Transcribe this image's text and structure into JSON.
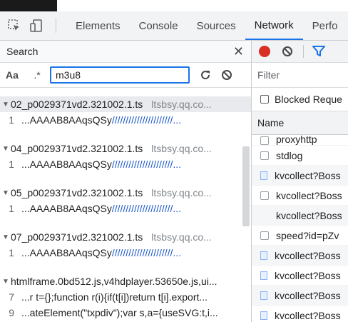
{
  "tabs": [
    "Elements",
    "Console",
    "Sources",
    "Network",
    "Perfo"
  ],
  "active_tab": "Network",
  "search": {
    "title": "Search",
    "case_label": "Aa",
    "regex_label": ".*",
    "query": "m3u8"
  },
  "results": [
    {
      "file": "02_p0029371vd2.321002.1.ts",
      "host": "ltsbsy.qq.co...",
      "lines": [
        {
          "n": "1",
          "pre": "...AAAAB8AAqsQSy",
          "slashes": "//////////////////////..."
        }
      ],
      "selected": true
    },
    {
      "file": "04_p0029371vd2.321002.1.ts",
      "host": "ltsbsy.qq.co...",
      "lines": [
        {
          "n": "1",
          "pre": "...AAAAB8AAqsQSy",
          "slashes": "//////////////////////..."
        }
      ]
    },
    {
      "file": "05_p0029371vd2.321002.1.ts",
      "host": "ltsbsy.qq.co...",
      "lines": [
        {
          "n": "1",
          "pre": "...AAAAB8AAqsQSy",
          "slashes": "//////////////////////..."
        }
      ]
    },
    {
      "file": "07_p0029371vd2.321002.1.ts",
      "host": "ltsbsy.qq.co...",
      "lines": [
        {
          "n": "1",
          "pre": "...AAAAB8AAqsQSy",
          "slashes": "//////////////////////..."
        }
      ]
    },
    {
      "file": "htmlframe.0bd512.js,v4hdplayer.53650e.js,ui...",
      "host": "",
      "lines": [
        {
          "n": "7",
          "pre": "...r t={};function r(i){if(t[i])return t[i].export...",
          "slashes": ""
        },
        {
          "n": "9",
          "pre": "...ateElement(\"txpdiv\");var s,a={useSVG:t,i...",
          "slashes": ""
        }
      ]
    }
  ],
  "network": {
    "filter_placeholder": "Filter",
    "blocked_label": "Blocked Reque",
    "name_header": "Name",
    "rows": [
      {
        "name": "proxyhttp",
        "icon": "blank"
      },
      {
        "name": "stdlog",
        "icon": "blank"
      },
      {
        "name": "kvcollect?Boss",
        "icon": "doc"
      },
      {
        "name": "kvcollect?Boss",
        "icon": "blank"
      },
      {
        "name": "kvcollect?Boss",
        "icon": "none"
      },
      {
        "name": "speed?id=pZv",
        "icon": "blank"
      },
      {
        "name": "kvcollect?Boss",
        "icon": "doc"
      },
      {
        "name": "kvcollect?Boss",
        "icon": "doc"
      },
      {
        "name": "kvcollect?Boss",
        "icon": "doc"
      },
      {
        "name": "kvcollect?Boss",
        "icon": "doc"
      }
    ]
  },
  "colors": {
    "accent": "#1a73e8",
    "record": "#d93025",
    "match_blue": "#1a56c8"
  }
}
